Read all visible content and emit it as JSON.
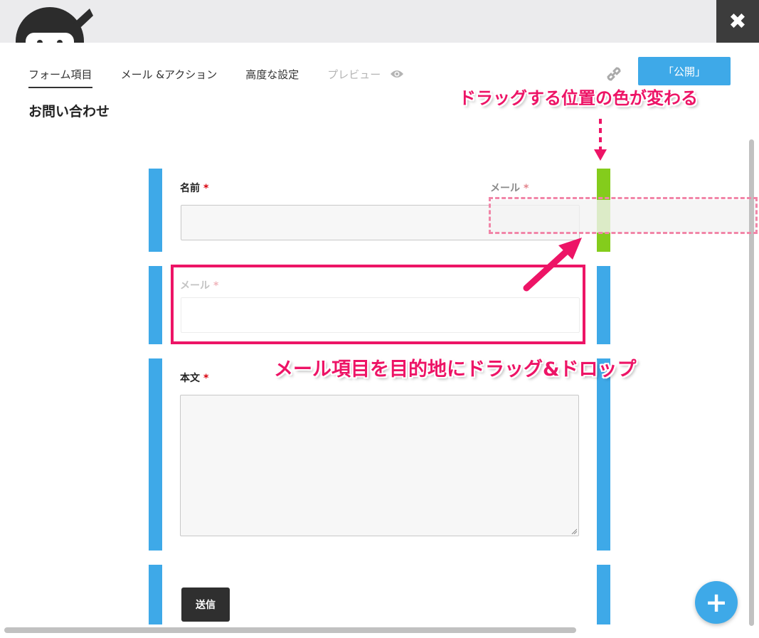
{
  "header": {
    "logo_icon": "ninja-mascot-icon",
    "close_icon": "close-x-icon",
    "close_symbol": "✖"
  },
  "tabs": [
    {
      "label": "フォーム項目",
      "active": true
    },
    {
      "label": "メール &アクション",
      "active": false
    },
    {
      "label": "高度な設定",
      "active": false
    },
    {
      "label": "プレビュー",
      "active": false,
      "disabled": true
    }
  ],
  "toolbar": {
    "link_icon": "link-icon",
    "publish_label": "「公開」"
  },
  "form": {
    "title": "お問い合わせ",
    "required_mark": "*",
    "fields": {
      "name": {
        "label": "名前",
        "value": ""
      },
      "email_ghost": {
        "label": "メール",
        "value": ""
      },
      "email_dragged": {
        "label": "メール",
        "value": ""
      },
      "message": {
        "label": "本文",
        "value": ""
      }
    },
    "submit_label": "送信"
  },
  "annotations": {
    "drop_hint": "ドラッグする位置の色が変わる",
    "drag_instruction": "メール項目を目的地にドラッグ&ドロップ"
  },
  "add_button_symbol": "+",
  "colors": {
    "accent_blue": "#3ea9e8",
    "drop_green": "#84cc1c",
    "annotation_pink": "#ed1466",
    "dark": "#2f2f2f"
  }
}
